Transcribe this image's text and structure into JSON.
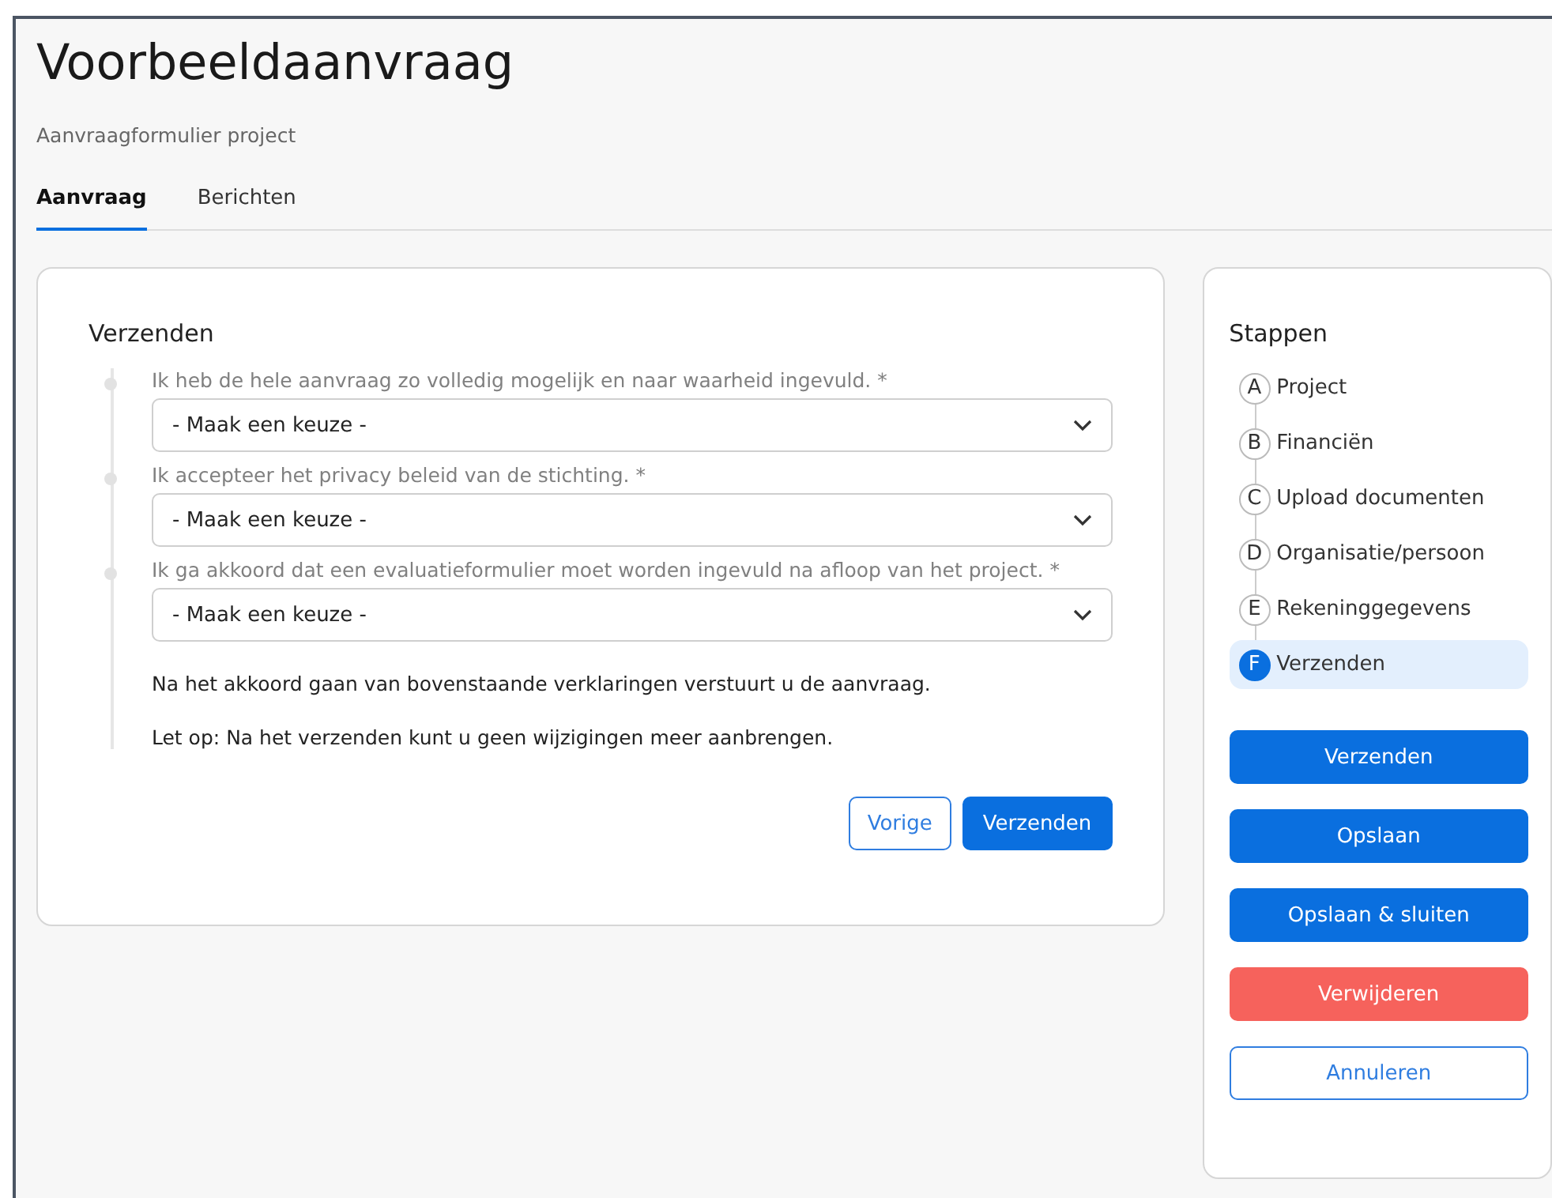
{
  "page": {
    "title": "Voorbeeldaanvraag",
    "subtitle": "Aanvraagformulier project"
  },
  "tabs": [
    {
      "label": "Aanvraag",
      "selected": true
    },
    {
      "label": "Berichten",
      "selected": false
    }
  ],
  "form": {
    "title": "Verzenden",
    "questions": [
      {
        "label": "Ik heb de hele aanvraag zo volledig mogelijk en naar waarheid ingevuld. *",
        "value": "- Maak een keuze -"
      },
      {
        "label": "Ik accepteer het privacy beleid van de stichting. *",
        "value": "- Maak een keuze -"
      },
      {
        "label": "Ik ga akkoord dat een evaluatieformulier moet worden ingevuld na afloop van het project. *",
        "value": "- Maak een keuze -"
      }
    ],
    "notes": [
      "Na het akkoord gaan van bovenstaande verklaringen verstuurt u de aanvraag.",
      "Let op: Na het verzenden kunt u geen wijzigingen meer aanbrengen."
    ],
    "buttons": [
      {
        "label": "Vorige",
        "kind": "outline"
      },
      {
        "label": "Verzenden",
        "kind": "primary"
      }
    ]
  },
  "steps": {
    "title": "Stappen",
    "items": [
      {
        "letter": "A",
        "label": "Project",
        "selected": false
      },
      {
        "letter": "B",
        "label": "Financiën",
        "selected": false
      },
      {
        "letter": "C",
        "label": "Upload documenten",
        "selected": false
      },
      {
        "letter": "D",
        "label": "Organisatie/persoon",
        "selected": false
      },
      {
        "letter": "E",
        "label": "Rekeninggegevens",
        "selected": false
      },
      {
        "letter": "F",
        "label": "Verzenden",
        "selected": true
      }
    ],
    "buttons": [
      {
        "label": "Verzenden",
        "kind": "primary"
      },
      {
        "label": "Opslaan",
        "kind": "primary"
      },
      {
        "label": "Opslaan & sluiten",
        "kind": "primary"
      },
      {
        "label": "Verwijderen",
        "kind": "danger"
      },
      {
        "label": "Annuleren",
        "kind": "outline"
      }
    ]
  }
}
